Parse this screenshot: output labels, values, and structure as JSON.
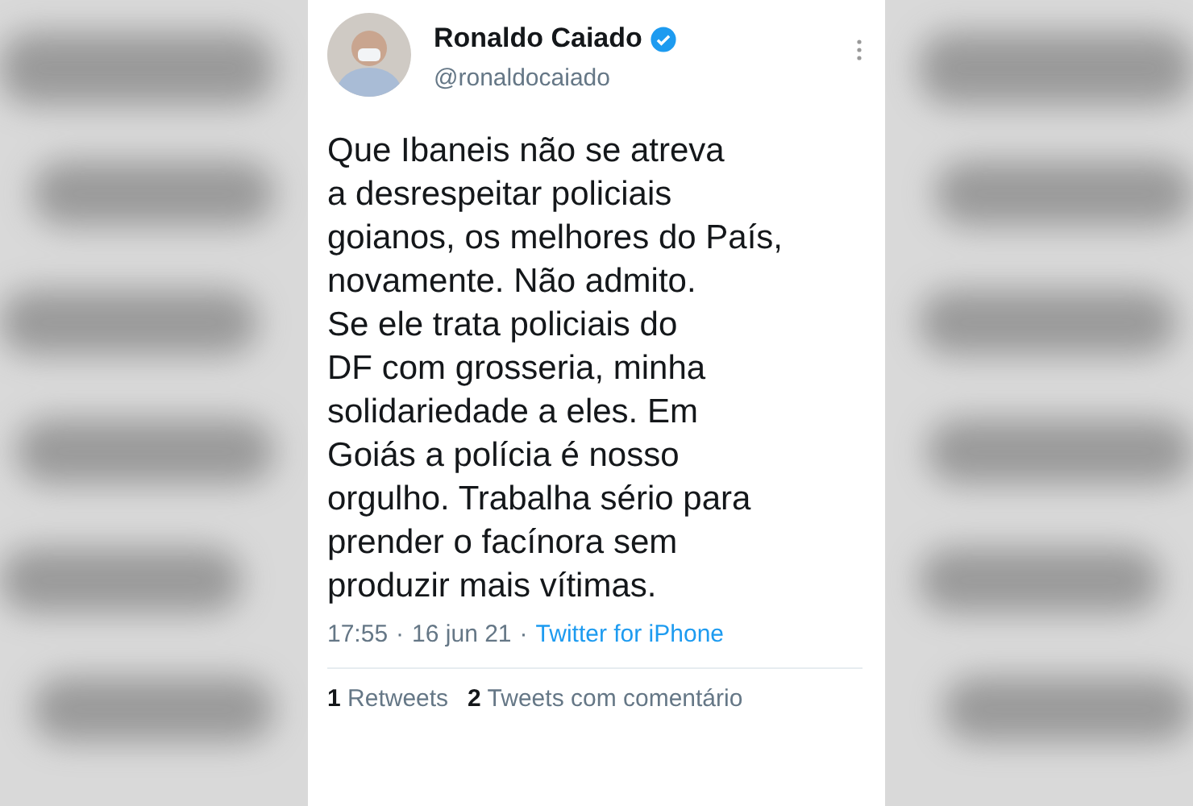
{
  "author": {
    "name": "Ronaldo Caiado",
    "verified": true,
    "handle": "@ronaldocaiado"
  },
  "tweet_text": "Que Ibaneis não se atreva\na desrespeitar policiais\ngoianos, os melhores do País,\nnovamente. Não admito.\nSe ele trata policiais do\nDF com grosseria, minha\nsolidariedade a eles. Em\nGoiás a polícia é nosso\norgulho. Trabalha sério para\nprender o facínora sem\nproduzir mais vítimas.",
  "meta": {
    "time": "17:55",
    "separator_1": "·",
    "date": "16 jun 21",
    "separator_2": "·",
    "source": "Twitter for iPhone"
  },
  "stats": [
    {
      "count": "1",
      "label": "Retweets"
    },
    {
      "count": "2",
      "label": "Tweets com comentário"
    }
  ]
}
